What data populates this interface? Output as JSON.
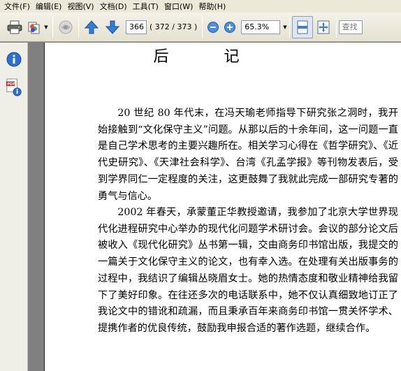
{
  "menu": {
    "items": [
      "文件(F)",
      "编辑(E)",
      "视图(V)",
      "文档(D)",
      "工具(T)",
      "窗口(W)",
      "帮助(H)"
    ]
  },
  "toolbar": {
    "current_page": "366",
    "page_count": "( 372 / 373 )",
    "zoom": "65.3%",
    "search_placeholder": "查找",
    "icons": [
      "print-icon",
      "pages-icon",
      "connect-icon",
      "prev-page-icon",
      "next-page-icon",
      "zoom-out-icon",
      "zoom-in-icon",
      "fit-width-icon",
      "fit-page-icon"
    ]
  },
  "sidebar": {
    "icons": [
      "info-icon",
      "pdf-info-icon"
    ]
  },
  "document": {
    "title": "后 记",
    "paragraphs": [
      "20 世纪 80 年代末，在冯天瑜老师指导下研究张之洞时，我开始接触到“文化保守主义”问题。从那以后的十余年间，这一问题一直是自己学术思考的主要兴趣所在。相关学习心得在《哲学研究》、《近代史研究》、《天津社会科学》、台湾《孔孟学报》等刊物发表后，受到学界同仁一定程度的关注，这更鼓舞了我就此完成一部研究专著的勇气与信心。",
      "2002 年春天，承蒙董正华教授邀请，我参加了北京大学世界现代化进程研究中心举办的现代化问题学术研讨会。会议的部分论文后被收入《现代化研究》丛书第一辑，交由商务印书馆出版，我提交的一篇关于文化保守主义的论文，也有幸入选。在处理有关出版事务的过程中，我结识了编辑丛晓眉女士。她的热情态度和敬业精神给我留下了美好印象。在往还多次的电话联系中，她不仅认真细致地订正了我论文中的错讹和疏漏，而且秉承百年来商务印书馆一贯关怀学术、提携作者的优良传统，鼓励我申报合适的著作选题，继续合作。"
    ]
  }
}
